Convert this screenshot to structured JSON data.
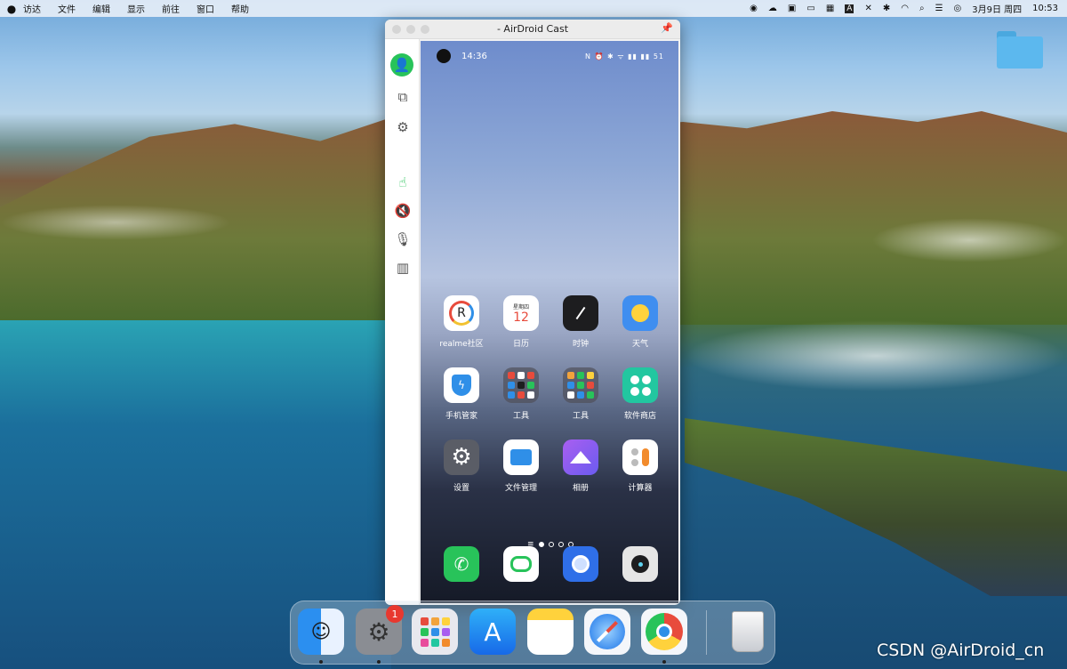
{
  "menubar": {
    "apple": "",
    "items": [
      "访达",
      "文件",
      "编辑",
      "显示",
      "前往",
      "窗口",
      "帮助"
    ],
    "date": "3月9日 周四",
    "time": "10:53"
  },
  "desktop": {
    "folder_label": ""
  },
  "window": {
    "title": "- AirDroid Cast"
  },
  "phone": {
    "status_time": "14:36",
    "status_icons": "N ⏰ ✱ ᯤ ▮▮ ▮▮ 51",
    "apps": [
      {
        "label": "realme社区"
      },
      {
        "label": "日历",
        "icon_text": "星期四",
        "icon_num": "12"
      },
      {
        "label": "时钟"
      },
      {
        "label": "天气"
      },
      {
        "label": "手机管家"
      },
      {
        "label": "工具"
      },
      {
        "label": "工具"
      },
      {
        "label": "软件商店"
      },
      {
        "label": "设置"
      },
      {
        "label": "文件管理"
      },
      {
        "label": "相册"
      },
      {
        "label": "计算器"
      }
    ],
    "page_indicator": {
      "current": 1,
      "count": 4
    }
  },
  "dock": {
    "badge": "1",
    "apps": [
      "Finder",
      "System Preferences",
      "Launchpad",
      "App Store",
      "Notes",
      "Safari",
      "Chrome",
      "Trash"
    ]
  },
  "watermark": "CSDN @AirDroid_cn",
  "colors": {
    "accent_green": "#28c35a",
    "badge_red": "#e8382f"
  }
}
